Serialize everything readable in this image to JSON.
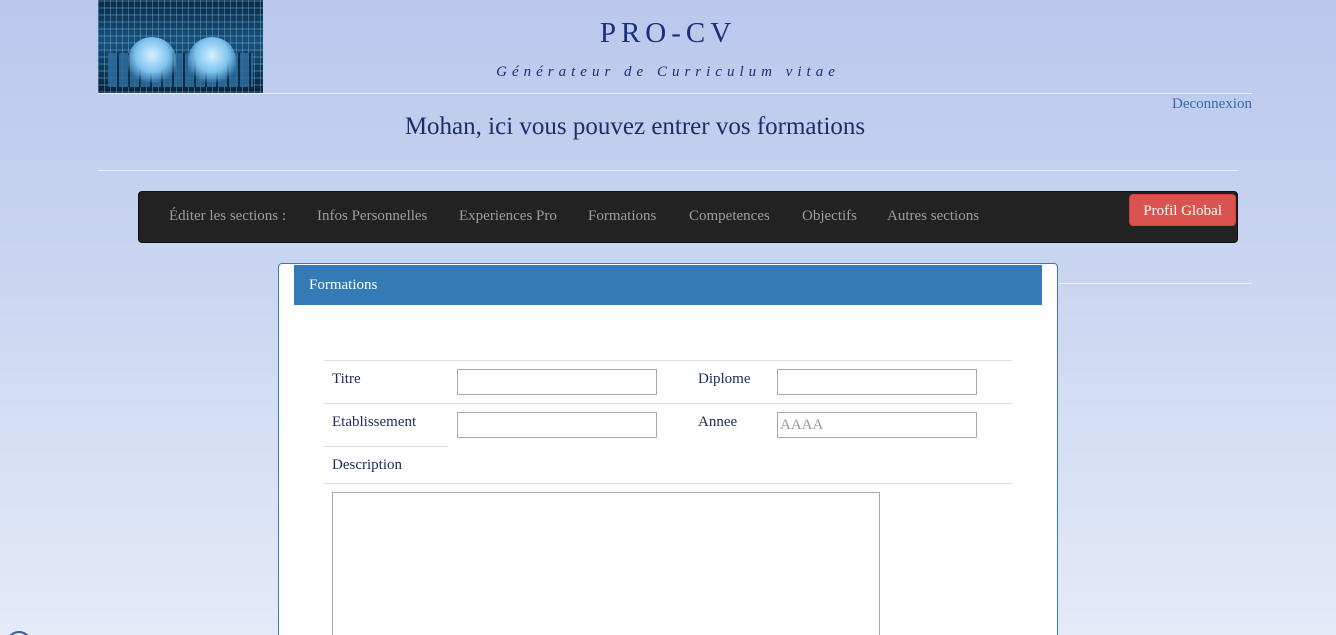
{
  "header": {
    "title": "PRO-CV",
    "subtitle": "Générateur de Curriculum vitae",
    "logout": "Deconnexion"
  },
  "page": {
    "heading": "Mohan, ici vous pouvez entrer vos formations"
  },
  "nav": {
    "label": "Éditer les sections :",
    "items": [
      {
        "label": "Infos Personnelles"
      },
      {
        "label": "Experiences Pro"
      },
      {
        "label": "Formations"
      },
      {
        "label": "Competences"
      },
      {
        "label": "Objectifs"
      },
      {
        "label": "Autres sections"
      }
    ],
    "profile_button": "Profil Global"
  },
  "form": {
    "panel_title": "Formations",
    "titre_label": "Titre",
    "titre_value": "",
    "diplome_label": "Diplome",
    "diplome_value": "",
    "etablissement_label": "Etablissement",
    "etablissement_value": "",
    "annee_label": "Annee",
    "annee_placeholder": "AAAA",
    "description_label": "Description",
    "description_value": ""
  },
  "colors": {
    "panel_primary": "#337ab7",
    "danger": "#d9534f",
    "navbar": "#222222"
  }
}
